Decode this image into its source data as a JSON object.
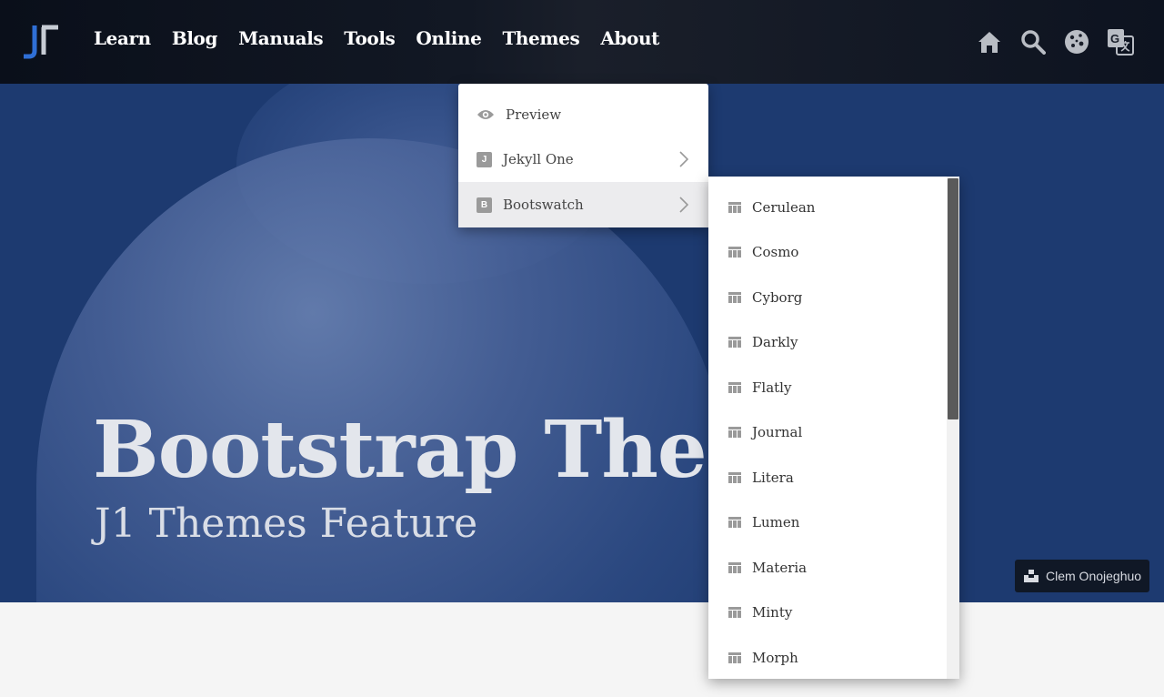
{
  "navbar": {
    "links": [
      {
        "label": "Learn"
      },
      {
        "label": "Blog"
      },
      {
        "label": "Manuals"
      },
      {
        "label": "Tools"
      },
      {
        "label": "Online"
      },
      {
        "label": "Themes"
      },
      {
        "label": "About"
      }
    ],
    "icons": [
      "home-icon",
      "search-icon",
      "cookie-icon",
      "translate-icon"
    ]
  },
  "hero": {
    "title": "Bootstrap Them",
    "subtitle": "J1 Themes Feature",
    "credit": "Clem Onojeghuo"
  },
  "dropdown": {
    "items": [
      {
        "label": "Preview",
        "icon": "eye-icon"
      },
      {
        "label": "Jekyll One",
        "badge": "J",
        "has_submenu": true
      },
      {
        "label": "Bootswatch",
        "badge": "B",
        "has_submenu": true,
        "active": true
      }
    ]
  },
  "submenu": {
    "items": [
      {
        "label": "Cerulean"
      },
      {
        "label": "Cosmo"
      },
      {
        "label": "Cyborg"
      },
      {
        "label": "Darkly"
      },
      {
        "label": "Flatly"
      },
      {
        "label": "Journal"
      },
      {
        "label": "Litera"
      },
      {
        "label": "Lumen"
      },
      {
        "label": "Materia"
      },
      {
        "label": "Minty"
      },
      {
        "label": "Morph"
      }
    ]
  },
  "colors": {
    "navbar": "#0d1320",
    "hero": "#1d3a70",
    "logo_blue": "#2f6fd6",
    "logo_gray": "#c7ccd4",
    "page_bg": "#f5f5f5"
  }
}
